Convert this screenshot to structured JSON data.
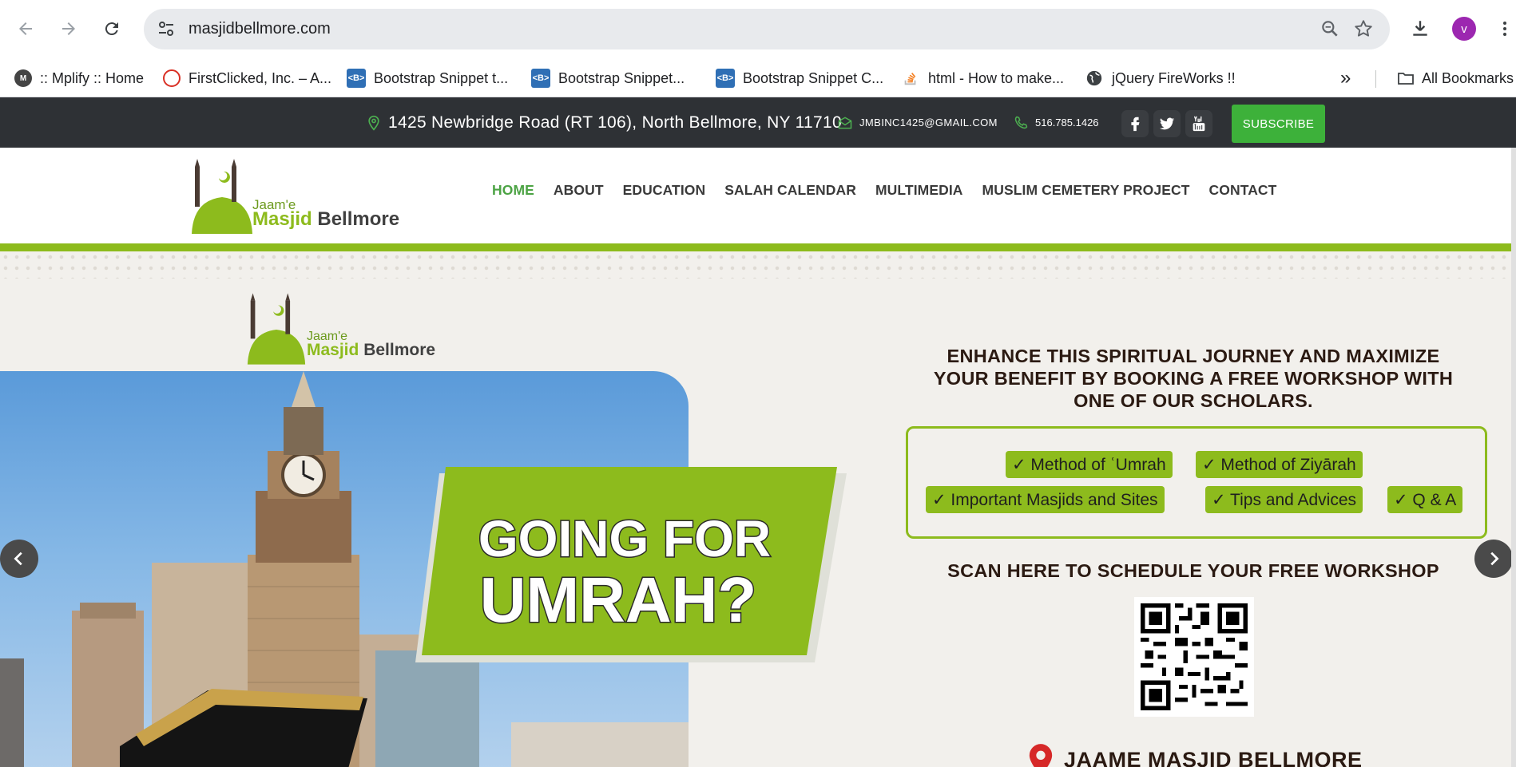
{
  "browser": {
    "url": "masjidbellmore.com",
    "profile_initial": "v",
    "bookmarks": [
      "::  Mplify :: Home",
      "FirstClicked, Inc. – A...",
      "Bootstrap Snippet t...",
      "Bootstrap Snippet...",
      "Bootstrap Snippet C...",
      "html - How to make...",
      "jQuery FireWorks !!"
    ],
    "bookmark_fav_b": "<B>",
    "all_bookmarks": "All Bookmarks",
    "more_chevrons": "»"
  },
  "topbar": {
    "address": "1425 Newbridge Road (RT 106), North Bellmore, NY 11710",
    "email": "JMBINC1425@GMAIL.COM",
    "phone": "516.785.1426",
    "subscribe": "SUBSCRIBE"
  },
  "logo": {
    "tag": "Jaam'e",
    "name_green": "Masjid",
    "name_dark": "Bellmore"
  },
  "nav": {
    "items": [
      "HOME",
      "ABOUT",
      "EDUCATION",
      "SALAH CALENDAR",
      "MULTIMEDIA",
      "MUSLIM CEMETERY PROJECT",
      "CONTACT"
    ],
    "active": "HOME"
  },
  "slide": {
    "headline_line1": "GOING FOR",
    "headline_line2": "UMRAH?",
    "enhance_heading_1": "ENHANCE THIS SPIRITUAL JOURNEY AND MAXIMIZE",
    "enhance_heading_2": "YOUR BENEFIT BY BOOKING A FREE WORKSHOP WITH",
    "enhance_heading_3": "ONE OF OUR SCHOLARS.",
    "topics": [
      "✓ Method of ʿUmrah",
      "✓ Method of Ziyārah",
      "✓ Important Masjids and Sites",
      "✓ Tips and Advices",
      "✓ Q & A"
    ],
    "scan_text": "SCAN HERE TO SCHEDULE YOUR FREE WORKSHOP",
    "location_name": "JAAME MASJID BELLMORE"
  },
  "colors": {
    "brand_green": "#8dbb1d",
    "nav_active": "#4ca344",
    "topbar_bg": "#2e3135",
    "subscribe_bg": "#3db13a"
  }
}
